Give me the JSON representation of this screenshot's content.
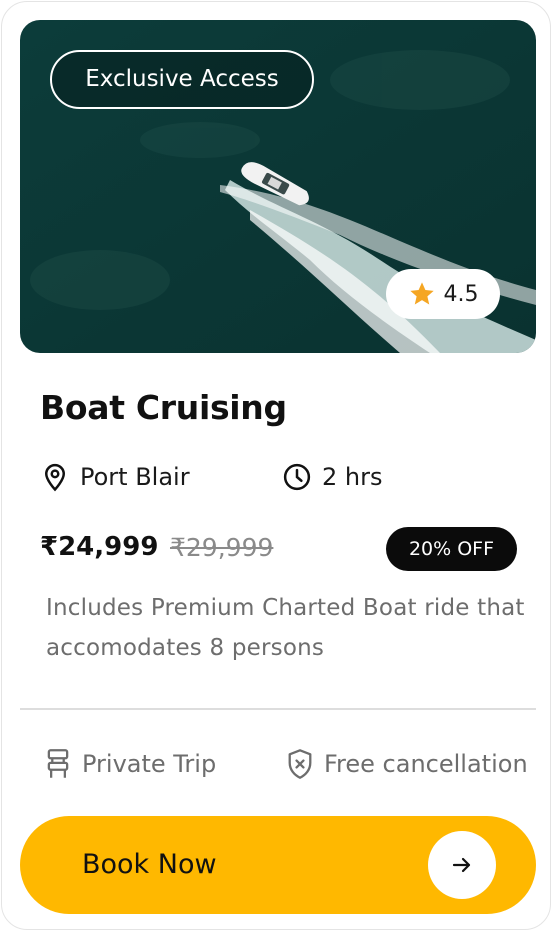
{
  "card": {
    "badge": "Exclusive Access",
    "rating": "4.5",
    "title": "Boat Cruising",
    "location": "Port Blair",
    "duration": "2 hrs",
    "price": "₹24,999",
    "original_price": "₹29,999",
    "discount": "20% OFF",
    "description": "Includes Premium Charted Boat ride that accomodates 8 persons",
    "features": [
      {
        "label": "Private Trip",
        "icon": "seat-icon"
      },
      {
        "label": "Free cancellation",
        "icon": "shield-x-icon"
      }
    ],
    "cta": "Book Now"
  },
  "colors": {
    "accent": "#ffb800",
    "water": "#0b3a36",
    "star": "#f5a623",
    "badge_dark": "#0b0b0b"
  }
}
